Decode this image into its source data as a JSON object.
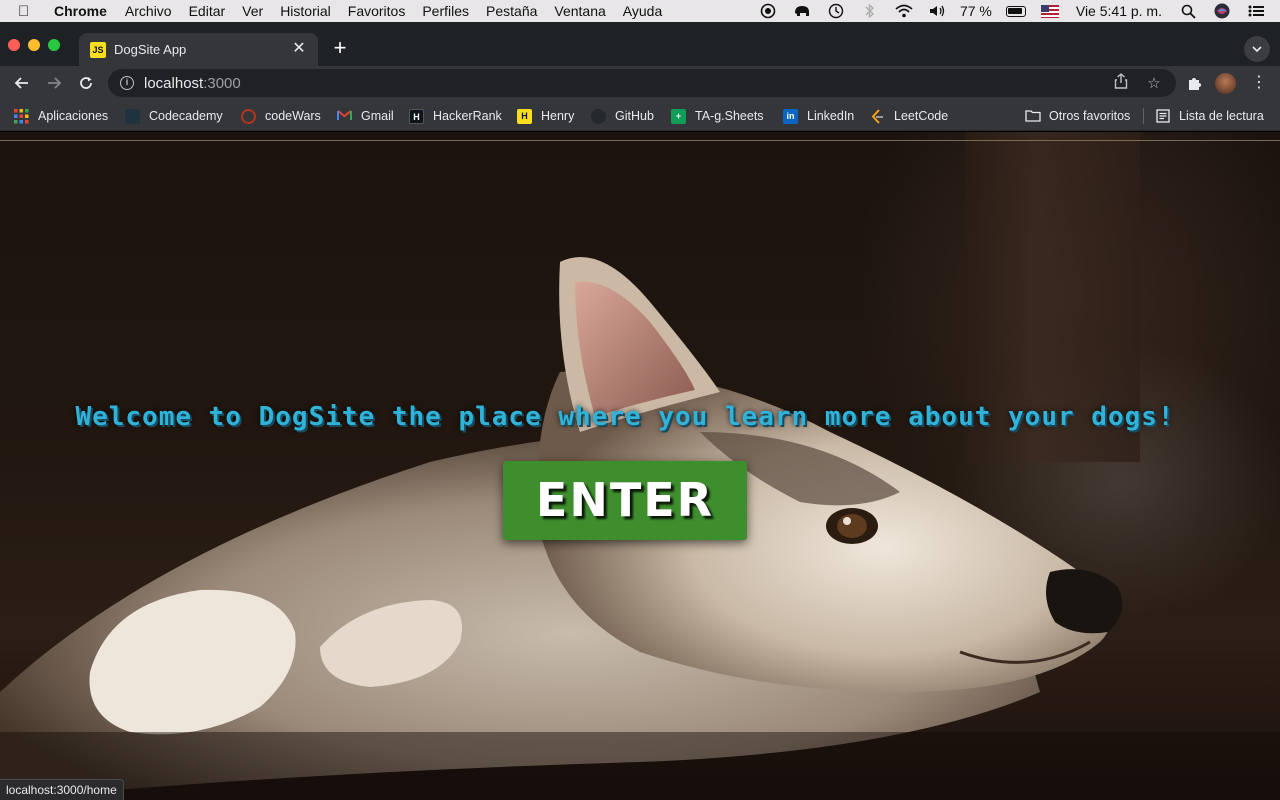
{
  "menubar": {
    "app_name": "Chrome",
    "items": [
      "Archivo",
      "Editar",
      "Ver",
      "Historial",
      "Favoritos",
      "Perfiles",
      "Pestaña",
      "Ventana",
      "Ayuda"
    ],
    "battery_percent": "77 %",
    "datetime": "Vie 5:41 p. m."
  },
  "tab": {
    "title": "DogSite App",
    "favicon_text": "JS"
  },
  "address": {
    "host": "localhost",
    "port": ":3000"
  },
  "bookmarks": {
    "items": [
      "Aplicaciones",
      "Codecademy",
      "codeWars",
      "Gmail",
      "HackerRank",
      "Henry",
      "GitHub",
      "TA-g.Sheets",
      "LinkedIn",
      "LeetCode"
    ],
    "other_favorites": "Otros favoritos",
    "reading_list": "Lista de lectura"
  },
  "page": {
    "welcome_text": "Welcome to DogSite the place where you learn more about your dogs!",
    "enter_label": "ENTER"
  },
  "status_url": "localhost:3000/home",
  "colors": {
    "title_text": "#2fb3d9",
    "enter_button": "#3e8e2e"
  }
}
